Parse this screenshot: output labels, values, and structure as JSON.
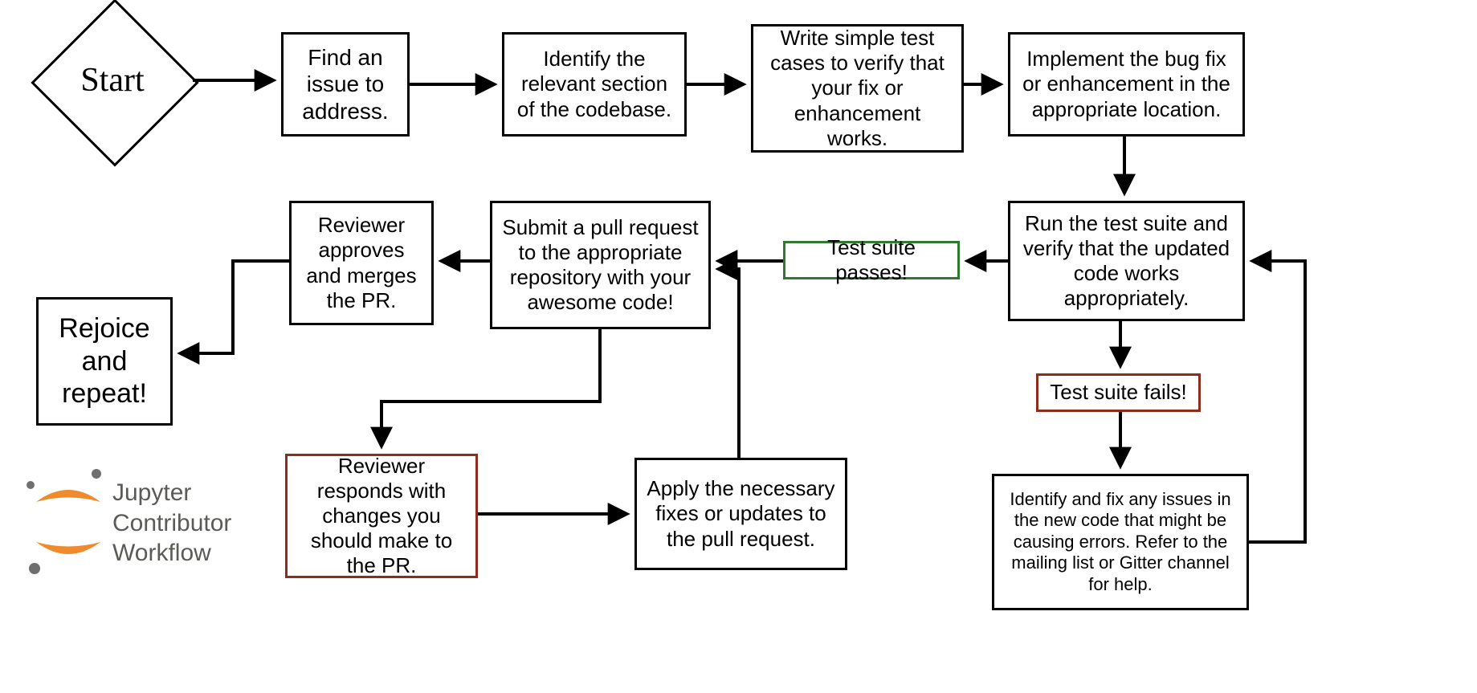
{
  "title": "Jupyter Contributor Workflow",
  "logo": {
    "line1": "Jupyter",
    "line2": "Contributor",
    "line3": "Workflow"
  },
  "nodes": {
    "start": "Start",
    "find_issue": "Find an issue to address.",
    "identify_section": "Identify the relevant section of the codebase.",
    "write_tests": "Write simple test cases to verify that your fix or enhancement works.",
    "implement": "Implement the bug fix or enhancement in the appropriate location.",
    "run_tests": "Run the test suite and verify that the updated code works appropriately.",
    "test_pass": "Test suite passes!",
    "test_fail": "Test suite fails!",
    "fix_issues": "Identify and fix any issues in the new code that might be causing errors. Refer to the mailing list or Gitter channel for help.",
    "submit_pr": "Submit a pull request to the appropriate repository with your awesome code!",
    "reviewer_changes": "Reviewer responds with changes you should make to the PR.",
    "apply_fixes": "Apply the necessary fixes or updates to the pull request.",
    "reviewer_merge": "Reviewer approves and merges the PR.",
    "rejoice": "Rejoice and repeat!"
  },
  "chart_data": {
    "type": "flowchart",
    "nodes": [
      {
        "id": "start",
        "label": "Start",
        "shape": "diamond"
      },
      {
        "id": "find_issue",
        "label": "Find an issue to address.",
        "shape": "rect"
      },
      {
        "id": "identify_section",
        "label": "Identify the relevant section of the codebase.",
        "shape": "rect"
      },
      {
        "id": "write_tests",
        "label": "Write simple test cases to verify that your fix or enhancement works.",
        "shape": "rect"
      },
      {
        "id": "implement",
        "label": "Implement the bug fix or enhancement in the appropriate location.",
        "shape": "rect"
      },
      {
        "id": "run_tests",
        "label": "Run the test suite and verify that the updated code works appropriately.",
        "shape": "rect"
      },
      {
        "id": "test_pass",
        "label": "Test suite passes!",
        "shape": "rect",
        "color": "green"
      },
      {
        "id": "test_fail",
        "label": "Test suite fails!",
        "shape": "rect",
        "color": "red"
      },
      {
        "id": "fix_issues",
        "label": "Identify and fix any issues in the new code that might be causing errors. Refer to the mailing list or Gitter channel for help.",
        "shape": "rect"
      },
      {
        "id": "submit_pr",
        "label": "Submit a pull request to the appropriate repository with your awesome code!",
        "shape": "rect"
      },
      {
        "id": "reviewer_changes",
        "label": "Reviewer responds with changes you should make to the PR.",
        "shape": "rect",
        "color": "red"
      },
      {
        "id": "apply_fixes",
        "label": "Apply the necessary fixes or updates to the pull request.",
        "shape": "rect"
      },
      {
        "id": "reviewer_merge",
        "label": "Reviewer approves and merges the PR.",
        "shape": "rect"
      },
      {
        "id": "rejoice",
        "label": "Rejoice and repeat!",
        "shape": "rect"
      }
    ],
    "edges": [
      {
        "from": "start",
        "to": "find_issue"
      },
      {
        "from": "find_issue",
        "to": "identify_section"
      },
      {
        "from": "identify_section",
        "to": "write_tests"
      },
      {
        "from": "write_tests",
        "to": "implement"
      },
      {
        "from": "implement",
        "to": "run_tests"
      },
      {
        "from": "run_tests",
        "to": "test_pass"
      },
      {
        "from": "run_tests",
        "to": "test_fail"
      },
      {
        "from": "test_fail",
        "to": "fix_issues"
      },
      {
        "from": "fix_issues",
        "to": "run_tests"
      },
      {
        "from": "test_pass",
        "to": "submit_pr"
      },
      {
        "from": "submit_pr",
        "to": "reviewer_merge"
      },
      {
        "from": "submit_pr",
        "to": "reviewer_changes"
      },
      {
        "from": "reviewer_changes",
        "to": "apply_fixes"
      },
      {
        "from": "apply_fixes",
        "to": "submit_pr"
      },
      {
        "from": "reviewer_merge",
        "to": "rejoice"
      }
    ]
  }
}
